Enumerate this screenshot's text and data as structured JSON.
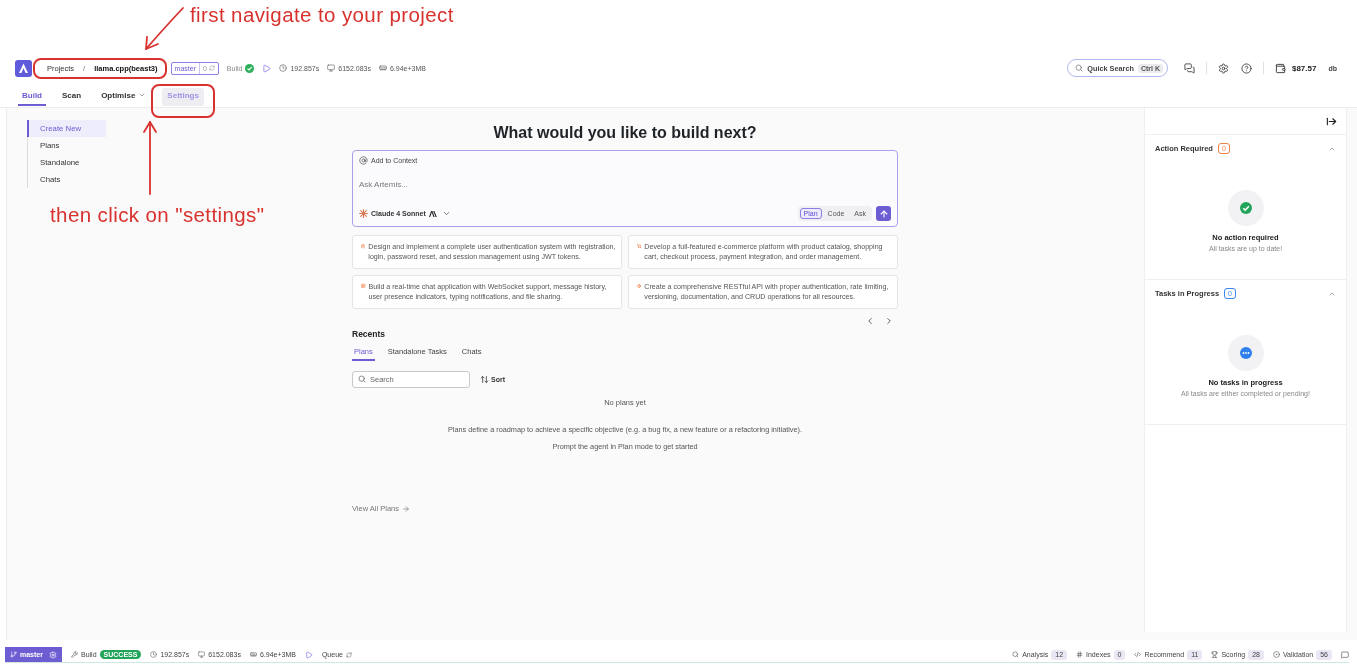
{
  "annotations": [
    {
      "text": "first navigate to your project"
    },
    {
      "text": "then click on \"settings\""
    }
  ],
  "header": {
    "breadcrumb": {
      "parent": "Projects",
      "separator": "/",
      "current": "llama.cpp(beast3)",
      "circled": true
    },
    "branch": {
      "name": "master",
      "count": "0"
    },
    "build": {
      "label": "Build",
      "ok": true
    },
    "stats": [
      {
        "kind": "clock",
        "value": "192.857s"
      },
      {
        "kind": "monitor",
        "value": "6152.083s"
      },
      {
        "kind": "memory",
        "value": "6.94e+3MB"
      }
    ],
    "quick_search": {
      "label": "Quick Search",
      "shortcut": "Ctrl K"
    },
    "balance": "$87.57",
    "user": "db"
  },
  "tabs": [
    {
      "label": "Build",
      "selected": true,
      "highlighted": false,
      "menu": false,
      "circled": false
    },
    {
      "label": "Scan",
      "selected": false,
      "highlighted": false,
      "menu": false,
      "circled": false
    },
    {
      "label": "Optimise",
      "selected": false,
      "highlighted": false,
      "menu": true,
      "circled": false
    },
    {
      "label": "Settings",
      "selected": false,
      "highlighted": true,
      "menu": false,
      "circled": true
    }
  ],
  "sidebar": {
    "items": [
      {
        "label": "Create New",
        "selected": true
      },
      {
        "label": "Plans",
        "selected": false
      },
      {
        "label": "Standalone",
        "selected": false
      },
      {
        "label": "Chats",
        "selected": false
      }
    ]
  },
  "composer": {
    "title": "What would you like to build next?",
    "context_button": "Add to Context",
    "placeholder": "Ask Artemis...",
    "model": "Claude 4 Sonnet",
    "modes": [
      {
        "label": "Plan",
        "selected": true
      },
      {
        "label": "Code",
        "selected": false
      },
      {
        "label": "Ask",
        "selected": false
      }
    ]
  },
  "suggestions": [
    {
      "kind": "lock",
      "text": "Design and implement a complete user authentication system with registration, login, password reset, and session management using JWT tokens."
    },
    {
      "kind": "cart",
      "text": "Develop a full-featured e-commerce platform with product catalog, shopping cart, checkout process, payment integration, and order management."
    },
    {
      "kind": "chat",
      "text": "Build a real-time chat application with WebSocket support, message history, user presence indicators, typing notifications, and file sharing."
    },
    {
      "kind": "api",
      "text": "Create a comprehensive RESTful API with proper authentication, rate limiting, versioning, documentation, and CRUD operations for all resources."
    }
  ],
  "recents": {
    "title": "Recents",
    "tabs": [
      {
        "label": "Plans",
        "selected": true
      },
      {
        "label": "Standalone Tasks",
        "selected": false
      },
      {
        "label": "Chats",
        "selected": false
      }
    ],
    "search": {
      "placeholder": "Search"
    },
    "sort": "Sort",
    "empty_title": "No plans yet",
    "empty_lines": [
      "Plans define a roadmap to achieve a specific objective (e.g. a bug fix, a new feature or a refactoring initiative).",
      "Prompt the agent in Plan mode to get started"
    ],
    "view_all": "View All Plans"
  },
  "right_panel": {
    "sections": [
      {
        "kind": "action",
        "title": "Action Required",
        "count": "0",
        "color": "#f0844a",
        "expanded": true,
        "empty_title": "No action required",
        "empty_subtitle": "All tasks are up to date!"
      },
      {
        "kind": "progress",
        "title": "Tasks in Progress",
        "count": "0",
        "color": "#3b86f0",
        "expanded": true,
        "empty_title": "No tasks in progress",
        "empty_subtitle": "All tasks are either completed or pending!"
      }
    ]
  },
  "status_bar": {
    "branch": "master",
    "build": {
      "label": "Build",
      "status": "SUCCESS",
      "ok": true
    },
    "stats": [
      {
        "kind": "clock",
        "value": "192.857s"
      },
      {
        "kind": "monitor",
        "value": "6152.083s"
      },
      {
        "kind": "memory",
        "value": "6.94e+3MB"
      }
    ],
    "queue": "Queue",
    "metrics": [
      {
        "kind": "analysis",
        "label": "Analysis",
        "count": "12"
      },
      {
        "kind": "indexes",
        "label": "Indexes",
        "count": "0"
      },
      {
        "kind": "recommend",
        "label": "Recommend",
        "count": "11"
      },
      {
        "kind": "scoring",
        "label": "Scoring",
        "count": "28"
      },
      {
        "kind": "validation",
        "label": "Validation",
        "count": "56"
      }
    ]
  }
}
